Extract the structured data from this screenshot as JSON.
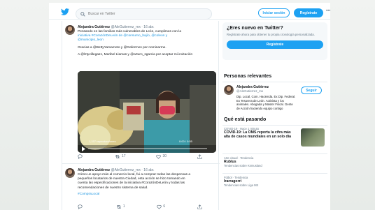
{
  "header": {
    "search_placeholder": "Buscar en Twitter",
    "login_label": "Iniciar sesión",
    "signup_label": "Regístrate",
    "more_label": "•••"
  },
  "tweets": [
    {
      "name": "Alejandra Gutiérrez",
      "handle": "@AleGutierrez_mx · 16 abr.",
      "lines": [
        "Pensando en las familias más vulnerables de León, cumplimos con la",
        "iniciativa #CorazónDeLeón de @consumo_bajío, @coleon y",
        "@municipio_leon"
      ],
      "line2": "Gracias a @BettyYamamoto y @Gaferrnes por nominarme.",
      "line3": "A @lztyvillegas1, Maribel Llamas y @arturo_sgarcia por aceptar mi invitación",
      "video_time": "0:00 / 0:55",
      "video_views": "1,157 reproducciones",
      "actions": {
        "reply": "",
        "retweet": "17",
        "like": "30",
        "share": ""
      }
    },
    {
      "name": "Alejandra Gutiérrez",
      "handle": "@AleGutierrez_mx · 16 abr.",
      "lines": [
        "Cómo un apoyo más al comercio local, fui a comprar todas las despensas a",
        "pequeños locatarios de nuestra Ciudad, esta acción se hizo tomando en",
        "cuenta las especificaciones de la iniciativa #CorazónDeLeón y todas las",
        "recomendaciones de nuestro sistema de salud."
      ],
      "hashtag": "#CompraLocal",
      "actions": {
        "reply": "",
        "retweet": "1",
        "like": "6",
        "share": ""
      }
    }
  ],
  "sidebar": {
    "new_title": "¿Eres nuevo en Twitter?",
    "new_text": "Regístrate ahora para obtener tu propia cronología personalizada.",
    "new_cta": "Regístrate",
    "relevant_title": "Personas relevantes",
    "person": {
      "name": "Alejandra Gutiérrez",
      "handle": "@AleGutierrez_mx",
      "bio": "Dip. Local, Com. Hacienda. Ex Dip. Federal. Ex Tesorera de León. Activista y los animales. Abogada y Master Fiscal. Gente de Acción haciendo equipo contigo",
      "follow_label": "Seguir"
    },
    "trends_title": "Qué está pasando",
    "trends": [
      {
        "ctx": "COVID-19 · Hace 1 minuto",
        "title": "COVID-19: La OMS reporta la cifra más alta de casos mundiales en un solo día",
        "sub": ""
      },
      {
        "ctx": "Arte visual · Tendencia",
        "title": "Rublus",
        "sub": "Tendencias sobre Ksmusland"
      },
      {
        "ctx": "Fútbol · Tendencia",
        "title": "Irarragorri",
        "sub": "Tendencias sobre Liga MX"
      }
    ]
  },
  "colors": {
    "accent": "#1da1f2",
    "link": "#1b95e0",
    "text": "#14171a",
    "muted": "#657786"
  }
}
